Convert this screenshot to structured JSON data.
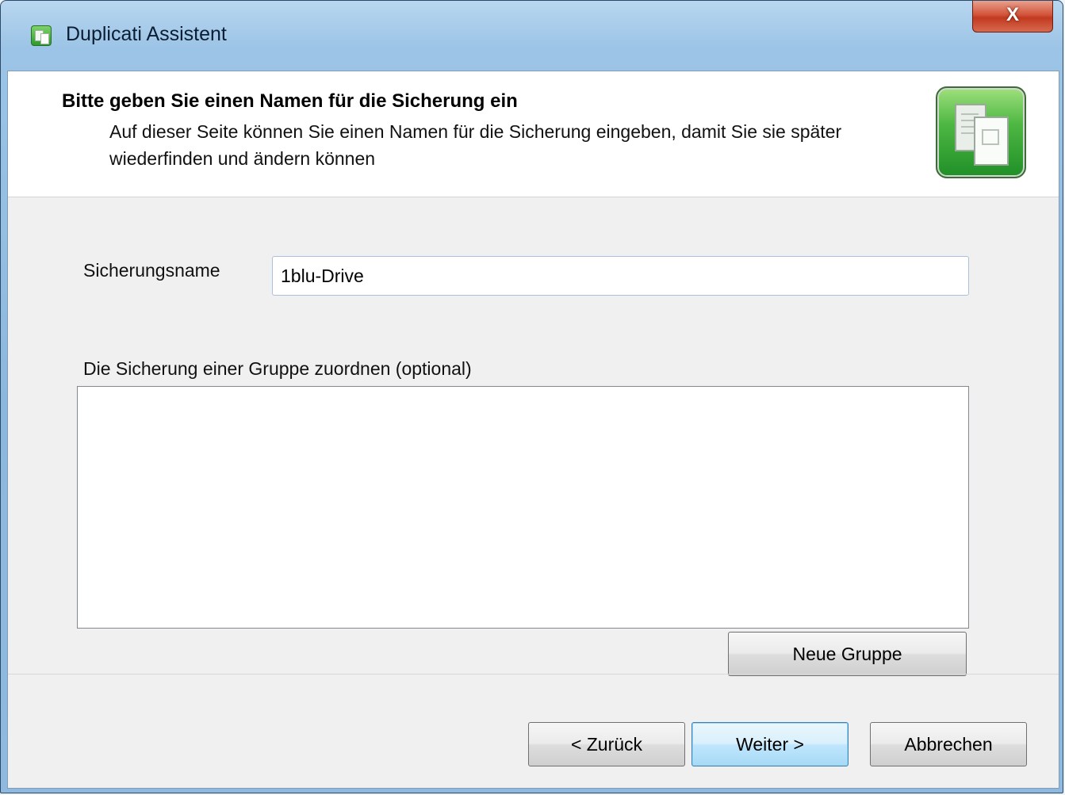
{
  "window": {
    "title": "Duplicati Assistent",
    "app_icon": "duplicati-app-icon",
    "close_label": "X"
  },
  "header": {
    "title": "Bitte geben Sie einen Namen für die Sicherung ein",
    "description": "Auf dieser Seite können Sie einen Namen für die Sicherung eingeben, damit Sie sie später wiederfinden und ändern können",
    "icon": "documents-icon"
  },
  "form": {
    "name_label": "Sicherungsname",
    "name_value": "1blu-Drive",
    "group_label": "Die Sicherung einer Gruppe zuordnen (optional)",
    "group_items": [],
    "new_group_label": "Neue Gruppe"
  },
  "footer": {
    "back_label": "< Zurück",
    "next_label": "Weiter >",
    "cancel_label": "Abbrechen"
  },
  "colors": {
    "accent": "#3c7fb1",
    "header_icon_green": "#4fb844",
    "close_red": "#c23a20"
  }
}
